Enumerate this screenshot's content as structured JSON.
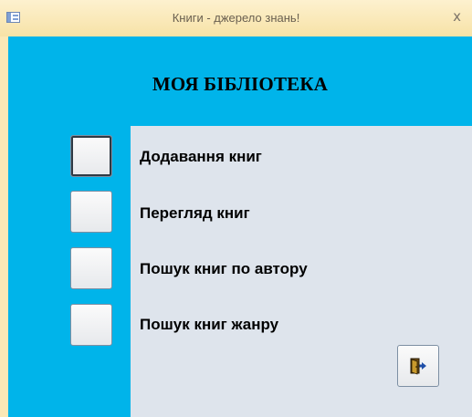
{
  "window": {
    "title": "Книги - джерело знань!",
    "close_glyph": "x",
    "app_icon": "form-icon"
  },
  "header": {
    "title": "МОЯ БІБЛІОТЕКА"
  },
  "menu": [
    {
      "label": "Додавання книг"
    },
    {
      "label": "Перегляд книг"
    },
    {
      "label": "Пошук книг по автору"
    },
    {
      "label": "Пошук книг жанру"
    }
  ],
  "exit_button": {
    "icon": "exit-door-icon"
  },
  "colors": {
    "background": "#00b4ea",
    "panel": "#dee4ec",
    "window_frame": "#fbe8b6"
  }
}
